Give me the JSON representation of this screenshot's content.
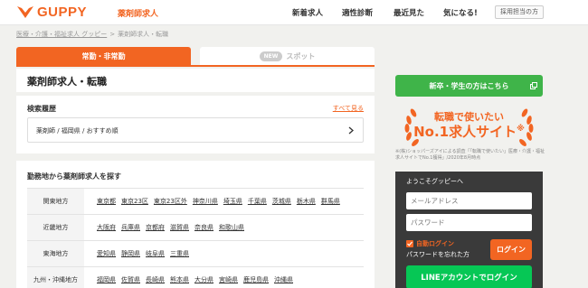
{
  "header": {
    "logo_text": "GUPPY",
    "site_label": "薬剤師求人",
    "nav": [
      {
        "label": "新着求人"
      },
      {
        "label": "適性診断"
      },
      {
        "label": "最近見た"
      },
      {
        "label": "気になる!"
      }
    ],
    "employer_label": "採用担当の方"
  },
  "breadcrumb": [
    {
      "label": "医療・介護・福祉求人 グッピー"
    },
    {
      "label": "薬剤師求人・転職"
    }
  ],
  "breadcrumb_sep": ">",
  "tabs": {
    "active_label": "常勤・非常勤",
    "new_badge": "NEW",
    "inactive_label": "スポット"
  },
  "page_title": "薬剤師求人・転職",
  "history": {
    "heading": "検索履歴",
    "all_link": "すべて見る",
    "item": "薬剤師 / 福岡県 / おすすめ順"
  },
  "area": {
    "heading": "勤務地から薬剤師求人を探す",
    "rows": [
      {
        "name": "関東地方",
        "prefs": [
          "東京都",
          "東京23区",
          "東京23区外",
          "神奈川県",
          "埼玉県",
          "千葉県",
          "茨城県",
          "栃木県",
          "群馬県"
        ]
      },
      {
        "name": "近畿地方",
        "prefs": [
          "大阪府",
          "兵庫県",
          "京都府",
          "滋賀県",
          "奈良県",
          "和歌山県"
        ]
      },
      {
        "name": "東海地方",
        "prefs": [
          "愛知県",
          "静岡県",
          "岐阜県",
          "三重県"
        ]
      },
      {
        "name": "九州・沖縄地方",
        "prefs": [
          "福岡県",
          "佐賀県",
          "長崎県",
          "熊本県",
          "大分県",
          "宮崎県",
          "鹿児島県",
          "沖縄県"
        ]
      }
    ]
  },
  "sidebar": {
    "new_grad_label": "新卒・学生の方はこちら",
    "award_line1": "転職で使いたい",
    "award_line2": "No.1求人サイト",
    "award_mark": "※",
    "award_note": "※(株)ショッパーズアイによる調査「「転職で使いたい」医療・介護・福祉求人サイトでNo.1獲得」/2020年8月時点",
    "login": {
      "welcome": "ようこそグッピーへ",
      "email_placeholder": "メールアドレス",
      "password_placeholder": "パスワード",
      "auto_login": "自動ログイン",
      "forgot": "パスワードを忘れた方",
      "login_button": "ログイン",
      "line_button": "LINEアカウントでログイン"
    }
  },
  "colors": {
    "brand": "#f26522",
    "green": "#3fb449",
    "line_green": "#06c755",
    "dark": "#3a3a3a"
  }
}
